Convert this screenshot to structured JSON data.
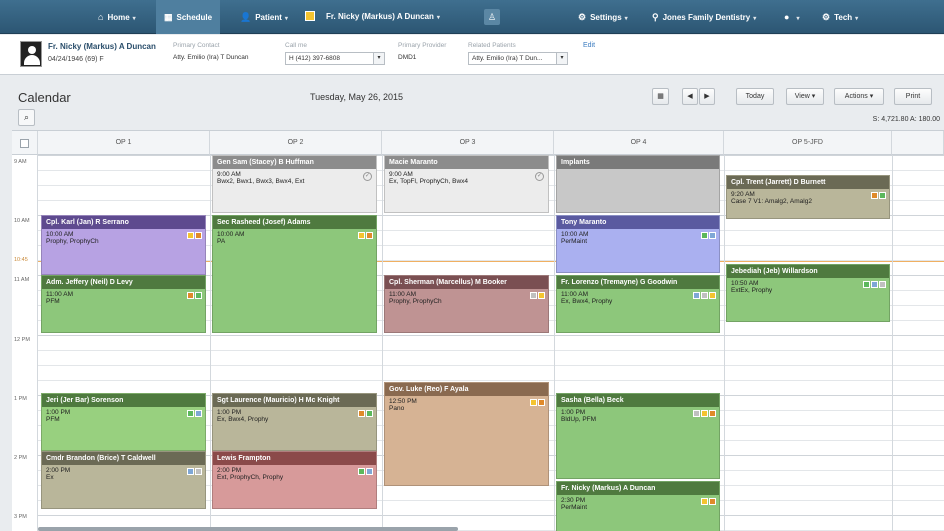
{
  "nav": {
    "home": "Home",
    "schedule": "Schedule",
    "patient": "Patient",
    "patient_name": "Fr. Nicky (Markus) A Duncan",
    "settings": "Settings",
    "practice": "Jones Family Dentistry",
    "help": "?",
    "user": "Tech"
  },
  "patient_bar": {
    "name": "Fr. Nicky (Markus) A Duncan",
    "dob": "04/24/1946 (69) F",
    "primary_contact_label": "Primary Contact",
    "primary_contact": "Atty. Emilio (Ira) T Duncan",
    "callme_label": "Call me",
    "callme": "H (412) 397-6808",
    "primary_provider_label": "Primary Provider",
    "primary_provider": "DMD1",
    "related_label": "Related Patients",
    "related": "Atty. Emilio (Ira) T Dun...",
    "edit": "Edit"
  },
  "calendar": {
    "title": "Calendar",
    "date": "Tuesday, May 26, 2015",
    "today": "Today",
    "view": "View",
    "actions": "Actions",
    "print": "Print",
    "totals": "S: 4,721.80   A: 180.00",
    "columns": [
      "OP 1",
      "OP 2",
      "OP 3",
      "OP 4",
      "OP 5-JFD"
    ],
    "times": [
      "9 AM",
      "10 AM",
      "10:45",
      "11 AM",
      "12 PM",
      "1 PM",
      "2 PM",
      "3 PM"
    ]
  },
  "appointments": [
    {
      "name": "Cpl. Karl (Jan) R Serrano",
      "time": "10:00 AM",
      "proc": "Prophy, ProphyCh",
      "hdr": "#5e4a8f",
      "bg": "#b7a2e3"
    },
    {
      "name": "Adm. Jeffery (Neil) D Levy",
      "time": "11:00 AM",
      "proc": "PFM",
      "hdr": "#4f7a3f",
      "bg": "#8dc77b"
    },
    {
      "name": "Jeri (Jer Bar) Sorenson",
      "time": "1:00 PM",
      "proc": "PFM",
      "hdr": "#4f7a3f",
      "bg": "#98d07f"
    },
    {
      "name": "Cmdr Brandon (Brice) T Caldwell",
      "time": "2:00 PM",
      "proc": "Ex",
      "hdr": "#6b6a55",
      "bg": "#b9b69a"
    },
    {
      "name": "Gen Sam (Stacey) B Huffman",
      "time": "9:00 AM",
      "proc": "Bwx2, Bwx1, Bwx3, Bwx4, Ext",
      "hdr": "#8c8c8c",
      "bg": "#ececec"
    },
    {
      "name": "Sec Rasheed (Josef) Adams",
      "time": "10:00 AM",
      "proc": "PA",
      "hdr": "#4f7a3f",
      "bg": "#8dc77b"
    },
    {
      "name": "Sgt Laurence (Mauricio) H Mc Knight",
      "time": "1:00 PM",
      "proc": "Ex, Bwx4, Prophy",
      "hdr": "#6b6a55",
      "bg": "#b9b69a"
    },
    {
      "name": "Lewis Frampton",
      "time": "2:00 PM",
      "proc": "Ext, ProphyCh, Prophy",
      "hdr": "#8b4a4a",
      "bg": "#d79a9a"
    },
    {
      "name": "Macie Maranto",
      "time": "9:00 AM",
      "proc": "Ex, TopFl, ProphyCh, Bwx4",
      "hdr": "#8c8c8c",
      "bg": "#ececec"
    },
    {
      "name": "Cpl. Sherman (Marcellus) M Booker",
      "time": "11:00 AM",
      "proc": "Prophy, ProphyCh",
      "hdr": "#7a4f52",
      "bg": "#bf9393"
    },
    {
      "name": "Gov. Luke (Reo) F Ayala",
      "time": "12:50 PM",
      "proc": "Pano",
      "hdr": "#8a6a50",
      "bg": "#d6b394"
    },
    {
      "name": "Implants",
      "time": "",
      "proc": "",
      "hdr": "#7a7a7a",
      "bg": "#c8c8c8"
    },
    {
      "name": "Tony Maranto",
      "time": "10:00 AM",
      "proc": "PerMaint",
      "hdr": "#5a5aa0",
      "bg": "#aab0f0"
    },
    {
      "name": "Fr. Lorenzo (Tremayne) G Goodwin",
      "time": "11:00 AM",
      "proc": "Ex, Bwx4, Prophy",
      "hdr": "#4f7a3f",
      "bg": "#8dc77b"
    },
    {
      "name": "Sasha (Bella) Beck",
      "time": "1:00 PM",
      "proc": "BldUp, PFM",
      "hdr": "#4f7a3f",
      "bg": "#8dc77b"
    },
    {
      "name": "Fr. Nicky (Markus) A Duncan",
      "time": "2:30 PM",
      "proc": "PerMaint",
      "hdr": "#4f7a3f",
      "bg": "#8dc77b"
    },
    {
      "name": "Cpl. Trent (Jarrett) D Burnett",
      "time": "9:20 AM",
      "proc": "Case 7 V1: Amalg2, Amalg2",
      "hdr": "#6b6a55",
      "bg": "#b9b69a"
    },
    {
      "name": "Jebediah (Jeb) Willardson",
      "time": "10:50 AM",
      "proc": "ExtEx, Prophy",
      "hdr": "#4f7a3f",
      "bg": "#8dc77b"
    }
  ],
  "colors": {
    "nav": "#2c5673",
    "now_line": "#f0b062",
    "link": "#3b7bbf"
  },
  "icons": [
    "home-icon",
    "calendar-icon",
    "user-icon",
    "gear-icon",
    "pin-icon",
    "help-icon",
    "search-icon",
    "calendar-picker-icon",
    "prev-icon",
    "next-icon"
  ]
}
